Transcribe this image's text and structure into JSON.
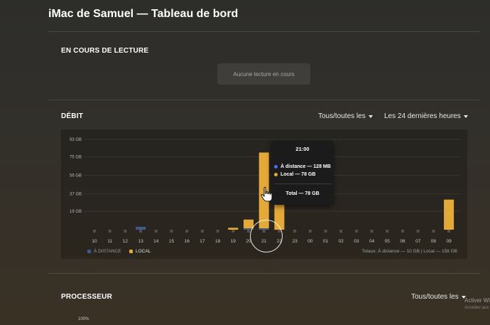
{
  "header": {
    "title": "iMac de Samuel — Tableau de bord"
  },
  "now_playing": {
    "label": "EN COURS DE LECTURE",
    "empty_text": "Aucune lecture en cours"
  },
  "bandwidth": {
    "label": "DÉBIT",
    "filter_users": "Tous/toutes les",
    "filter_range": "Les 24 dernières heures",
    "legend_remote": "À DISTANCE",
    "legend_local": "LOCAL",
    "totals": "Totaux: À distance — 10 GB | Local — 158 GB",
    "colors": {
      "remote": "#3e5a8a",
      "local": "#e5a938"
    }
  },
  "tooltip": {
    "time": "21:00",
    "remote": "À distance — 128 MB",
    "local": "Local — 78 GB",
    "total": "Total — 78 GB"
  },
  "chart_data": {
    "type": "bar",
    "categories": [
      "10",
      "11",
      "12",
      "13",
      "14",
      "15",
      "16",
      "17",
      "18",
      "19",
      "20",
      "21",
      "22",
      "23",
      "00",
      "01",
      "02",
      "03",
      "04",
      "05",
      "06",
      "07",
      "08",
      "09"
    ],
    "y_ticks": [
      "19 GB",
      "37 GB",
      "56 GB",
      "75 GB",
      "93 GB"
    ],
    "ylim": [
      0,
      93
    ],
    "series": [
      {
        "name": "À DISTANCE",
        "values": [
          0,
          0,
          0,
          3,
          0,
          0,
          0,
          0,
          0,
          0,
          0.5,
          0.1,
          0,
          0,
          0,
          0,
          0,
          0,
          0,
          0,
          0,
          0,
          0,
          0
        ]
      },
      {
        "name": "LOCAL",
        "values": [
          0,
          0,
          0,
          0,
          0,
          0,
          0,
          0,
          0,
          2,
          9,
          78,
          27,
          0,
          0,
          0,
          0,
          0,
          0,
          0,
          0,
          0,
          0,
          31
        ]
      }
    ],
    "grid": true
  },
  "processor": {
    "label": "PROCESSEUR",
    "filter_users": "Tous/toutes les",
    "axis_top": "100%"
  },
  "watermark": {
    "line1": "Activer Wi",
    "line2": "Accédez aux"
  }
}
